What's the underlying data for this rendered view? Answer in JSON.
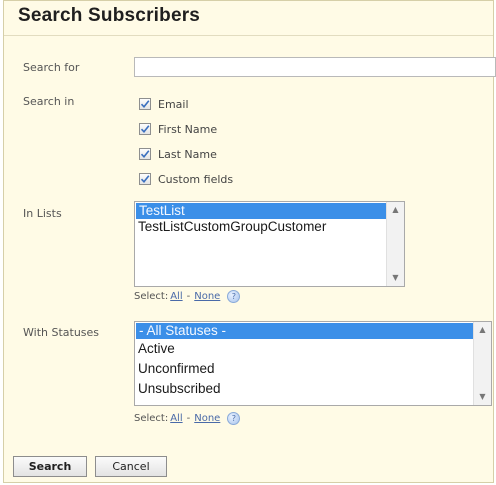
{
  "dialog": {
    "title": "Search Subscribers"
  },
  "search_for": {
    "label": "Search for",
    "value": "",
    "placeholder": ""
  },
  "search_in": {
    "label": "Search in",
    "options": [
      {
        "label": "Email",
        "checked": true
      },
      {
        "label": "First Name",
        "checked": true
      },
      {
        "label": "Last Name",
        "checked": true
      },
      {
        "label": "Custom fields",
        "checked": true
      }
    ]
  },
  "in_lists": {
    "label": "In Lists",
    "items": [
      {
        "label": "TestList",
        "selected": true
      },
      {
        "label": "TestListCustomGroupCustomer",
        "selected": false
      }
    ],
    "select_prefix": "Select:",
    "select_all": "All",
    "select_separator": "-",
    "select_none": "None"
  },
  "with_statuses": {
    "label": "With Statuses",
    "items": [
      {
        "label": "- All Statuses -",
        "selected": true
      },
      {
        "label": "Active",
        "selected": false
      },
      {
        "label": "Unconfirmed",
        "selected": false
      },
      {
        "label": "Unsubscribed",
        "selected": false
      }
    ],
    "select_prefix": "Select:",
    "select_all": "All",
    "select_separator": "-",
    "select_none": "None"
  },
  "buttons": {
    "search": "Search",
    "cancel": "Cancel"
  },
  "colors": {
    "selection": "#3b8fe8",
    "panel_bg": "#fffbe6",
    "link": "#4a6aa8"
  }
}
